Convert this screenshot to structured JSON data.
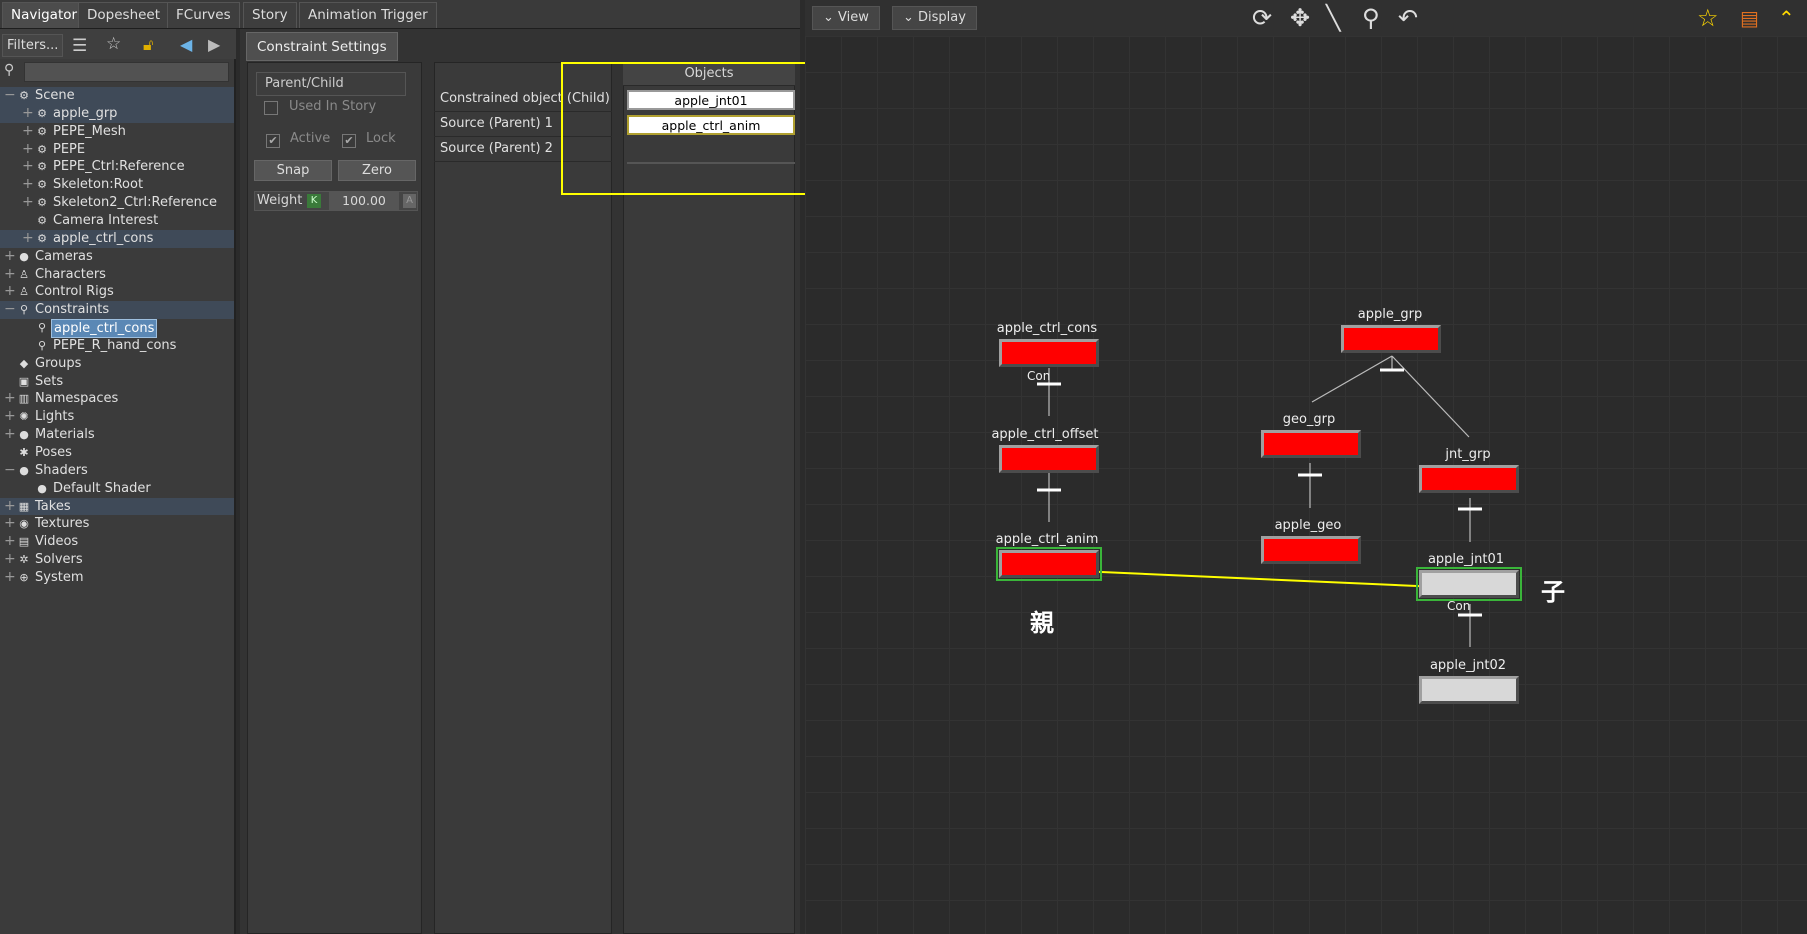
{
  "tabs": [
    "Navigator",
    "Dopesheet",
    "FCurves",
    "Story",
    "Animation Trigger"
  ],
  "navigator": {
    "filters_label": "Filters...",
    "tree": [
      {
        "label": "Scene",
        "indent": 0,
        "expander": "−",
        "icon": "⚙",
        "hl": true
      },
      {
        "label": "apple_grp",
        "indent": 1,
        "expander": "+",
        "icon": "⚙",
        "hl": true
      },
      {
        "label": "PEPE_Mesh",
        "indent": 1,
        "expander": "+",
        "icon": "⚙"
      },
      {
        "label": "PEPE",
        "indent": 1,
        "expander": "+",
        "icon": "⚙"
      },
      {
        "label": "PEPE_Ctrl:Reference",
        "indent": 1,
        "expander": "+",
        "icon": "⚙"
      },
      {
        "label": "Skeleton:Root",
        "indent": 1,
        "expander": "+",
        "icon": "⚙"
      },
      {
        "label": "Skeleton2_Ctrl:Reference",
        "indent": 1,
        "expander": "+",
        "icon": "⚙"
      },
      {
        "label": "Camera Interest",
        "indent": 1,
        "expander": "",
        "icon": "⚙"
      },
      {
        "label": "apple_ctrl_cons",
        "indent": 1,
        "expander": "+",
        "icon": "⚙",
        "hl": true
      },
      {
        "label": "Cameras",
        "indent": 0,
        "expander": "+",
        "icon": "●"
      },
      {
        "label": "Characters",
        "indent": 0,
        "expander": "+",
        "icon": "♙"
      },
      {
        "label": "Control Rigs",
        "indent": 0,
        "expander": "+",
        "icon": "♙"
      },
      {
        "label": "Constraints",
        "indent": 0,
        "expander": "−",
        "icon": "⚲",
        "hl": true
      },
      {
        "label": "apple_ctrl_cons",
        "indent": 1,
        "expander": "",
        "icon": "⚲",
        "sel": true
      },
      {
        "label": "PEPE_R_hand_cons",
        "indent": 1,
        "expander": "",
        "icon": "⚲"
      },
      {
        "label": "Groups",
        "indent": 0,
        "expander": "",
        "icon": "◆"
      },
      {
        "label": "Sets",
        "indent": 0,
        "expander": "",
        "icon": "▣"
      },
      {
        "label": "Namespaces",
        "indent": 0,
        "expander": "+",
        "icon": "▥"
      },
      {
        "label": "Lights",
        "indent": 0,
        "expander": "+",
        "icon": "✺"
      },
      {
        "label": "Materials",
        "indent": 0,
        "expander": "+",
        "icon": "●"
      },
      {
        "label": "Poses",
        "indent": 0,
        "expander": "",
        "icon": "✱"
      },
      {
        "label": "Shaders",
        "indent": 0,
        "expander": "−",
        "icon": "●"
      },
      {
        "label": "Default Shader",
        "indent": 1,
        "expander": "",
        "icon": "●"
      },
      {
        "label": "Takes",
        "indent": 0,
        "expander": "+",
        "icon": "▦",
        "hl": true
      },
      {
        "label": "Textures",
        "indent": 0,
        "expander": "+",
        "icon": "◉"
      },
      {
        "label": "Videos",
        "indent": 0,
        "expander": "+",
        "icon": "▤"
      },
      {
        "label": "Solvers",
        "indent": 0,
        "expander": "+",
        "icon": "✲"
      },
      {
        "label": "System",
        "indent": 0,
        "expander": "+",
        "icon": "⊕"
      }
    ]
  },
  "constraint": {
    "tab_label": "Constraint Settings",
    "type": "Parent/Child",
    "used_in_story": "Used In Story",
    "active": "Active",
    "lock": "Lock",
    "snap": "Snap",
    "zero": "Zero",
    "weight_label": "Weight",
    "weight_key": "K",
    "weight_value": "100.00",
    "weight_a": "A",
    "objects_header": "Objects",
    "rows": [
      {
        "label": "Constrained object (Child)",
        "value": "apple_jnt01"
      },
      {
        "label": "Source (Parent) 1",
        "value": "apple_ctrl_anim"
      },
      {
        "label": "Source (Parent) 2",
        "value": ""
      }
    ]
  },
  "schematic": {
    "view_btn": "View",
    "display_btn": "Display",
    "nodes": {
      "apple_ctrl_cons": "apple_ctrl_cons",
      "apple_ctrl_offset": "apple_ctrl_offset",
      "apple_ctrl_anim": "apple_ctrl_anim",
      "apple_grp": "apple_grp",
      "geo_grp": "geo_grp",
      "apple_geo": "apple_geo",
      "jnt_grp": "jnt_grp",
      "apple_jnt01": "apple_jnt01",
      "apple_jnt02": "apple_jnt02"
    },
    "con_label": "Con",
    "parent_annotation": "親",
    "child_annotation": "子",
    "colors": {
      "node_red": "#ff0000",
      "node_grey": "#d8d8d8",
      "selection": "#3ab53a",
      "highlight": "#ffff00"
    }
  }
}
